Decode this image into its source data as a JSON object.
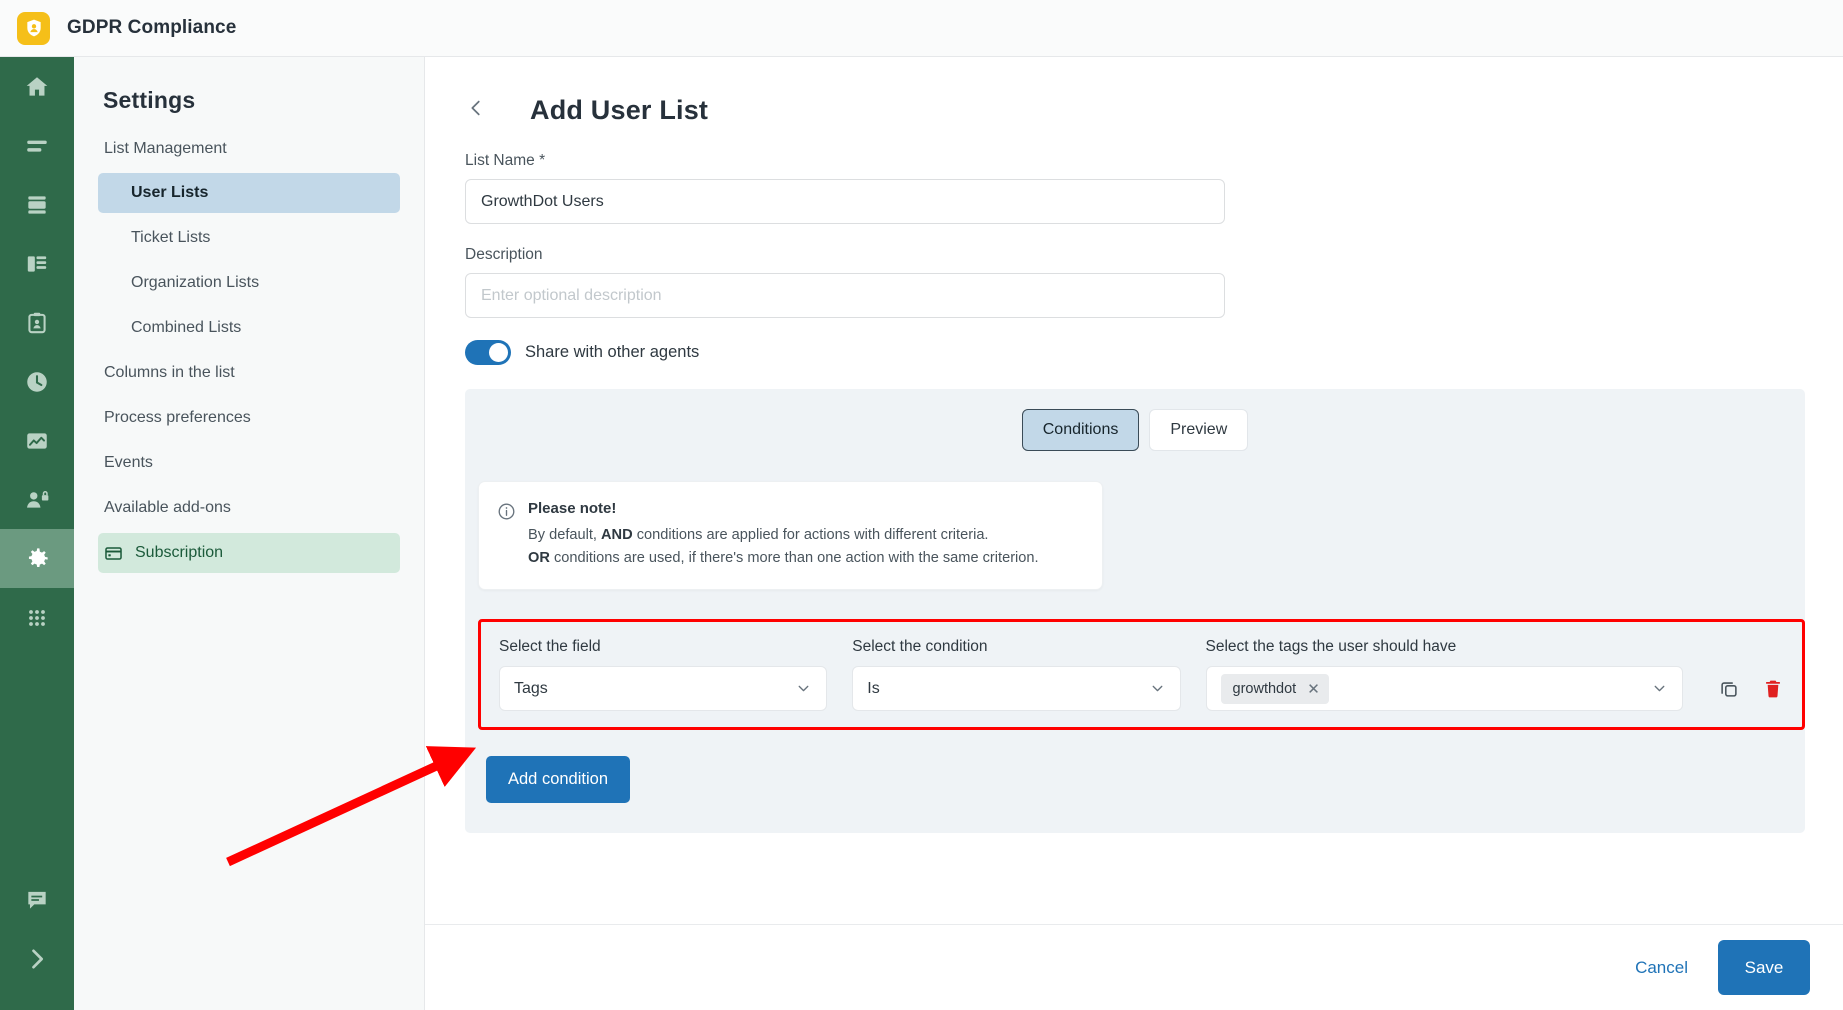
{
  "topbar": {
    "app_title": "GDPR Compliance",
    "logo_icon": "shield-user-icon",
    "logo_color": "#f5bf19"
  },
  "rail": {
    "background": "#2f6a4a",
    "active_background": "#6b9a80",
    "items": [
      {
        "icon": "home-icon",
        "active": false
      },
      {
        "icon": "lines-icon",
        "active": false
      },
      {
        "icon": "card-stack-icon",
        "active": false
      },
      {
        "icon": "organization-icon",
        "active": false
      },
      {
        "icon": "clipboard-user-icon",
        "active": false
      },
      {
        "icon": "clock-icon",
        "active": false
      },
      {
        "icon": "chart-icon",
        "active": false
      },
      {
        "icon": "user-lock-icon",
        "active": false
      },
      {
        "icon": "gear-icon",
        "active": true
      },
      {
        "icon": "apps-grid-icon",
        "active": false
      }
    ],
    "bottom_items": [
      {
        "icon": "chat-icon"
      },
      {
        "icon": "chevron-right-icon"
      }
    ]
  },
  "settings": {
    "title": "Settings",
    "group_label": "List Management",
    "items": [
      {
        "label": "User Lists",
        "sub": true,
        "state": "active-blue",
        "icon": null
      },
      {
        "label": "Ticket Lists",
        "sub": true,
        "state": "",
        "icon": null
      },
      {
        "label": "Organization Lists",
        "sub": true,
        "state": "",
        "icon": null
      },
      {
        "label": "Combined Lists",
        "sub": true,
        "state": "",
        "icon": null
      },
      {
        "label": "Columns in the list",
        "sub": false,
        "state": "",
        "icon": null
      },
      {
        "label": "Process preferences",
        "sub": false,
        "state": "",
        "icon": null
      },
      {
        "label": "Events",
        "sub": false,
        "state": "",
        "icon": null
      },
      {
        "label": "Available add-ons",
        "sub": false,
        "state": "",
        "icon": null
      },
      {
        "label": "Subscription",
        "sub": false,
        "state": "active-green",
        "icon": "credit-card-icon"
      }
    ]
  },
  "page": {
    "back_icon": "chevron-left-icon",
    "title": "Add User List",
    "list_name_label": "List Name *",
    "list_name_value": "GrowthDot Users",
    "description_label": "Description",
    "description_value": "",
    "description_placeholder": "Enter optional description",
    "share_toggle_label": "Share with other agents",
    "share_toggle_on": true
  },
  "conditions_card": {
    "tabs": [
      {
        "label": "Conditions",
        "selected": true
      },
      {
        "label": "Preview",
        "selected": false
      }
    ],
    "note": {
      "icon": "info-icon",
      "title": "Please note!",
      "line1_pre": "By default, ",
      "line1_bold": "AND",
      "line1_post": " conditions are applied for actions with different criteria.",
      "line2_bold": "OR",
      "line2_post": " conditions are used, if there's more than one action with the same criterion."
    },
    "condition_row": {
      "field_label": "Select the field",
      "field_value": "Tags",
      "condition_label": "Select the condition",
      "condition_value": "Is",
      "tags_label": "Select the tags the user should have",
      "tags": [
        {
          "label": "growthdot",
          "remove_icon": "close-icon"
        }
      ],
      "copy_icon": "copy-icon",
      "delete_icon": "trash-icon",
      "highlight_color": "#ff0000"
    },
    "add_condition_label": "Add condition"
  },
  "footer": {
    "cancel_label": "Cancel",
    "save_label": "Save",
    "primary_color": "#1f73b7"
  },
  "annotation": {
    "arrow_color": "#ff0000"
  }
}
